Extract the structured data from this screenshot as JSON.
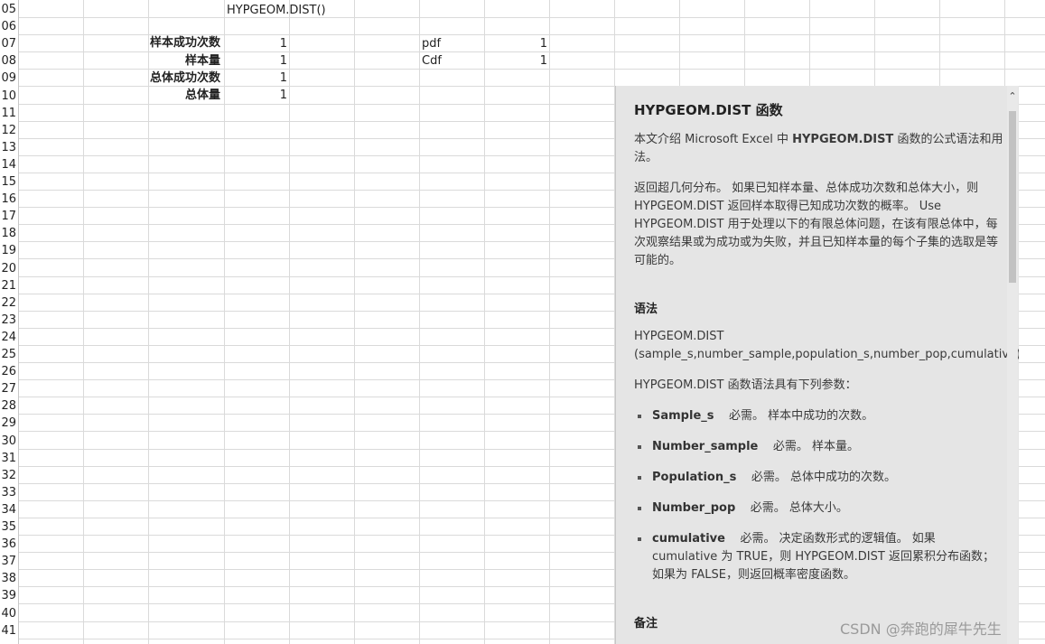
{
  "rows": [
    "05",
    "06",
    "07",
    "08",
    "09",
    "10",
    "11",
    "12",
    "13",
    "14",
    "15",
    "16",
    "17",
    "18",
    "19",
    "20",
    "21",
    "22",
    "23",
    "24",
    "25",
    "26",
    "27",
    "28",
    "29",
    "30",
    "31",
    "32",
    "33",
    "34",
    "35",
    "36",
    "37",
    "38",
    "39",
    "40",
    "41"
  ],
  "cells": {
    "formula": "HYPGEOM.DIST()",
    "label_sample_s": "样本成功次数",
    "label_sample": "样本量",
    "label_population_s": "总体成功次数",
    "label_pop": "总体量",
    "val_sample_s": "1",
    "val_sample": "1",
    "val_population_s": "1",
    "val_pop": "1",
    "label_pdf": "pdf",
    "label_cdf": "Cdf",
    "val_pdf": "1",
    "val_cdf": "1"
  },
  "help": {
    "title": "HYPGEOM.DIST 函数",
    "intro_pre": "本文介绍 Microsoft Excel 中 ",
    "intro_bold": "HYPGEOM.DIST",
    "intro_post": " 函数的公式语法和用法。",
    "desc": "返回超几何分布。 如果已知样本量、总体成功次数和总体大小，则 HYPGEOM.DIST 返回样本取得已知成功次数的概率。 Use HYPGEOM.DIST 用于处理以下的有限总体问题，在该有限总体中，每次观察结果或为成功或为失败，并且已知样本量的每个子集的选取是等可能的。",
    "syntax_heading": "语法",
    "syntax_line1": "HYPGEOM.DIST",
    "syntax_line2": "(sample_s,number_sample,population_s,number_pop,cumulative)",
    "args_intro": "HYPGEOM.DIST 函数语法具有下列参数：",
    "args": [
      {
        "name": "Sample_s",
        "desc": "必需。 样本中成功的次数。"
      },
      {
        "name": "Number_sample",
        "desc": "必需。 样本量。"
      },
      {
        "name": "Population_s",
        "desc": "必需。 总体中成功的次数。"
      },
      {
        "name": "Number_pop",
        "desc": "必需。 总体大小。"
      },
      {
        "name": "cumulative",
        "desc": "必需。 决定函数形式的逻辑值。 如果 cumulative 为 TRUE，则 HYPGEOM.DIST 返回累积分布函数；如果为 FALSE，则返回概率密度函数。"
      }
    ],
    "notes_heading": "备注",
    "scroll_up_icon": "chevron-up-icon"
  },
  "watermark": "CSDN @奔跑的犀牛先生",
  "colors": {
    "pane_bg": "#e5e5e5",
    "grid": "#dadada"
  }
}
